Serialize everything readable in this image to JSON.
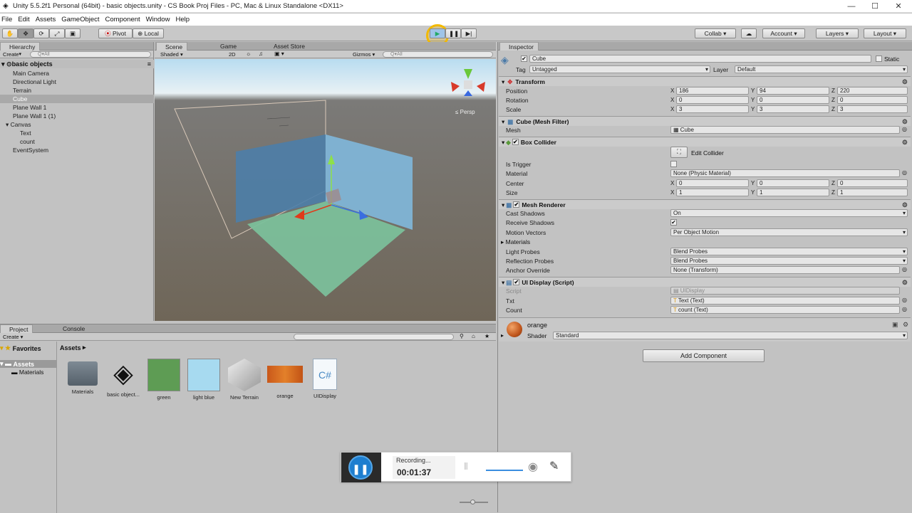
{
  "window": {
    "title": "Unity 5.5.2f1 Personal (64bit) - basic objects.unity - CS Book Proj Files - PC, Mac & Linux Standalone <DX11>",
    "controls": [
      "—",
      "☐",
      "✕"
    ]
  },
  "menu": [
    "File",
    "Edit",
    "Assets",
    "GameObject",
    "Component",
    "Window",
    "Help"
  ],
  "toolbar": {
    "pivot": "Pivot",
    "local": "Local",
    "collab": "Collab",
    "account": "Account",
    "layers": "Layers",
    "layout": "Layout",
    "accent": "#f2b900"
  },
  "hierarchy": {
    "tab": "Hierarchy",
    "create": "Create",
    "search_placeholder": "Q▾All",
    "scene": "basic objects",
    "items": [
      "Main Camera",
      "Directional Light",
      "Terrain",
      "Cube",
      "Plane Wall 1",
      "Plane Wall 1 (1)",
      "Canvas",
      "Text",
      "count",
      "EventSystem"
    ]
  },
  "scene": {
    "tabs": [
      "Scene",
      "Game",
      "Asset Store"
    ],
    "shaded": "Shaded",
    "mode_2d": "2D",
    "gizmos": "Gizmos",
    "search_placeholder": "Q▾All",
    "persp": "≤ Persp"
  },
  "project": {
    "tabs": [
      "Project",
      "Console"
    ],
    "create": "Create",
    "favorites": "Favorites",
    "assets_root": "Assets",
    "materials": "Materials",
    "breadcrumb": "Assets",
    "assets": [
      "Materials",
      "basic object...",
      "green",
      "light blue",
      "New Terrain",
      "orange",
      "UIDisplay"
    ]
  },
  "inspector": {
    "tab": "Inspector",
    "name": "Cube",
    "static": "Static",
    "tag_label": "Tag",
    "tag": "Untagged",
    "layer_label": "Layer",
    "layer": "Default",
    "transform": {
      "title": "Transform",
      "position_label": "Position",
      "rotation_label": "Rotation",
      "scale_label": "Scale",
      "position": [
        "186",
        "94",
        "220"
      ],
      "rotation": [
        "0",
        "0",
        "0"
      ],
      "scale": [
        "3",
        "3",
        "3"
      ]
    },
    "mesh_filter": {
      "title": "Cube (Mesh Filter)",
      "mesh_label": "Mesh",
      "mesh": "Cube"
    },
    "box_collider": {
      "title": "Box Collider",
      "edit": "Edit Collider",
      "is_trigger": "Is Trigger",
      "material_label": "Material",
      "material": "None (Physic Material)",
      "center_label": "Center",
      "size_label": "Size",
      "center": [
        "0",
        "0",
        "0"
      ],
      "size": [
        "1",
        "1",
        "1"
      ]
    },
    "mesh_renderer": {
      "title": "Mesh Renderer",
      "cast_shadows_label": "Cast Shadows",
      "cast_shadows": "On",
      "receive_shadows_label": "Receive Shadows",
      "motion_vectors_label": "Motion Vectors",
      "motion_vectors": "Per Object Motion",
      "materials_label": "Materials",
      "light_probes_label": "Light Probes",
      "light_probes": "Blend Probes",
      "reflection_probes_label": "Reflection Probes",
      "reflection_probes": "Blend Probes",
      "anchor_override_label": "Anchor Override",
      "anchor_override": "None (Transform)"
    },
    "ui_display": {
      "title": "UI Display (Script)",
      "script_label": "Script",
      "script": "UIDisplay",
      "txt_label": "Txt",
      "txt": "Text (Text)",
      "count_label": "Count",
      "count": "count (Text)"
    },
    "material": {
      "name": "orange",
      "shader_label": "Shader",
      "shader": "Standard"
    },
    "add_component": "Add Component"
  },
  "recording": {
    "status": "Recording...",
    "time": "00:01:37"
  }
}
